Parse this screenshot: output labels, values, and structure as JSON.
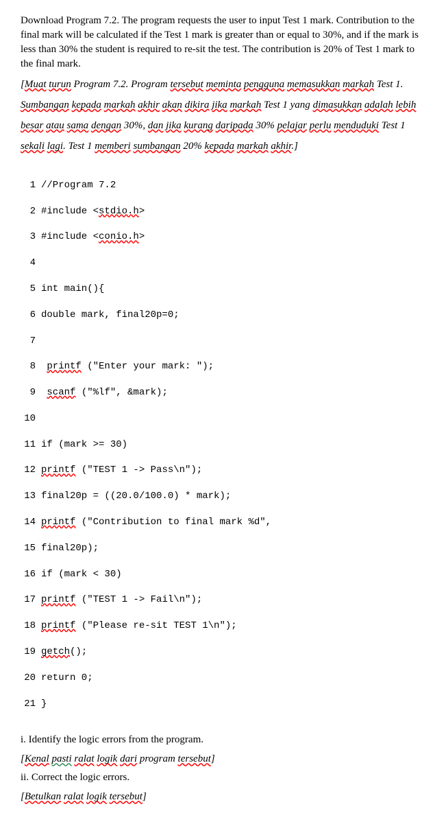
{
  "intro": {
    "p1": "Download Program 7.2. The program requests the user to input Test 1 mark. Contribution to the final mark will be calculated if the Test 1 mark is greater than or equal to 30%, and if the mark is less than 30% the student is required to re-sit the test. The contribution is 20% of Test 1 mark to the final mark."
  },
  "malay": {
    "open_bracket": "[",
    "w1": "Muat",
    "w2": "turun",
    "w3": " Program 7.2. Program ",
    "w4": "tersebut",
    "w5": "meminta",
    "w6": "pengguna",
    "w7": "memasukkan",
    "w8": "markah",
    "w9": " Test 1. ",
    "w10": "Sumbangan",
    "w11": "kepada",
    "w12": "markah",
    "w13": "akhir",
    "w14": "akan",
    "w15": "dikira",
    "w16": "jika",
    "w17": "markah",
    "w18": " Test 1 yang ",
    "w19": "dimasukkan",
    "w20": "adalah",
    "w21": "lebih",
    "w22": "besar",
    "w23": "atau",
    "w24": "sama",
    "w25": "dengan",
    "w26": " 30%, ",
    "w27": "dan",
    "w28": "jika",
    "w29": "kurang",
    "w30": "daripada",
    "w31": " 30% ",
    "w32": "pelajar",
    "w33": "perlu",
    "w34": "menduduki",
    "w35": " Test 1 ",
    "w36": "sekali",
    "w37": "lagi",
    "w38": ". Test 1 ",
    "w39": "memberi",
    "w40": "sumbangan",
    "w41": "20% ",
    "w42": "kepada",
    "w43": "markah",
    "w44": "akhir",
    "w45": ".",
    "close_bracket": "]"
  },
  "code": {
    "l1": "//Program 7.2",
    "l2a": "#include <",
    "l2b": "stdio.h",
    "l2c": ">",
    "l3a": "#include <",
    "l3b": "conio.h",
    "l3c": ">",
    "l4": "",
    "l5": "int main(){",
    "l6": "double mark, final20p=0;",
    "l7": "",
    "l8a": " ",
    "l8b": "printf",
    "l8c": " (\"Enter your mark: \");",
    "l9a": " ",
    "l9b": "scanf",
    "l9c": " (\"%lf\", &mark);",
    "l10": "",
    "l11": "if (mark >= 30)",
    "l12a": "printf",
    "l12b": " (\"TEST 1 -> Pass\\n\");",
    "l13": "final20p = ((20.0/100.0) * mark);",
    "l14a": "printf",
    "l14b": " (\"Contribution to final mark %d\",",
    "l15": "final20p);",
    "l16": "if (mark < 30)",
    "l17a": "printf",
    "l17b": " (\"TEST 1 -> Fail\\n\");",
    "l18a": "printf",
    "l18b": " (\"Please re-sit TEST 1\\n\");",
    "l19a": "getch",
    "l19b": "();",
    "l20": "return 0;",
    "l21": "}"
  },
  "questions": {
    "q1": "i. Identify the logic errors from the program.",
    "q1m_open": "[",
    "q1m_w1": "Kenal",
    "q1m_w2": "pasti",
    "q1m_w3": "ralat",
    "q1m_w4": "logik",
    "q1m_w5": "dari",
    "q1m_w6": " program ",
    "q1m_w7": "tersebut",
    "q1m_close": "]",
    "q2": "ii. Correct the logic errors.",
    "q2m_open": "[",
    "q2m_w1": "Betulkan",
    "q2m_w2": "ralat",
    "q2m_w3": "logik",
    "q2m_w4": "tersebut",
    "q2m_close": "]"
  }
}
